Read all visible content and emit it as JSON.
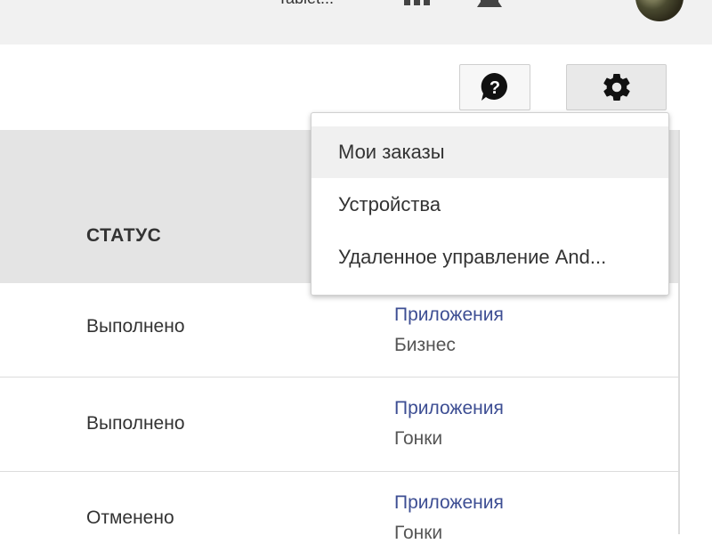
{
  "topbar": {
    "partial_text": "Tablet...",
    "dot_text": "·",
    "icons": [
      "apps-icon",
      "bell-icon"
    ]
  },
  "toolbar": {
    "help_icon": "help-icon",
    "settings_icon": "gear-icon"
  },
  "table": {
    "header_status": "СТАТУС",
    "rows": [
      {
        "status": "Выполнено",
        "category": "Приложения",
        "subcategory": "Бизнес"
      },
      {
        "status": "Выполнено",
        "category": "Приложения",
        "subcategory": "Гонки"
      },
      {
        "status": "Отменено",
        "category": "Приложения",
        "subcategory": "Гонки"
      }
    ]
  },
  "menu": {
    "items": [
      {
        "label": "Мои заказы",
        "active": true
      },
      {
        "label": "Устройства",
        "active": false
      },
      {
        "label": "Удаленное управление And...",
        "active": false
      }
    ]
  },
  "colors": {
    "link": "#3d4e93",
    "header_bg": "#e4e4e4",
    "topbar_bg": "#f1f1f1"
  }
}
